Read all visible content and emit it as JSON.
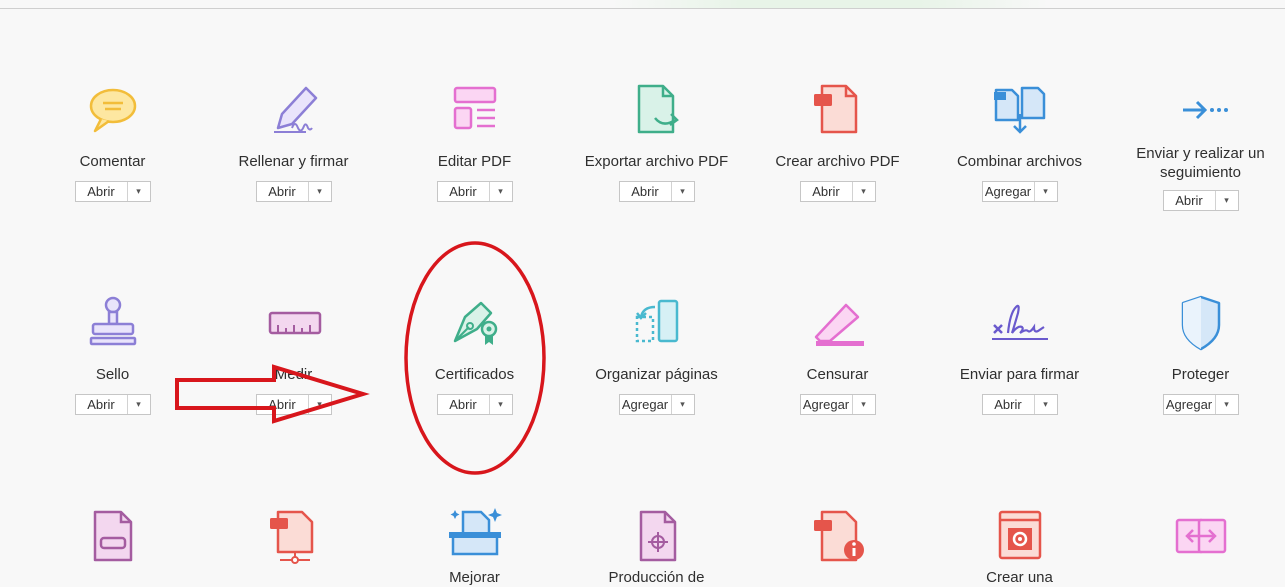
{
  "buttons": {
    "open": "Abrir",
    "add": "Agregar",
    "caret": "▾"
  },
  "row1": [
    {
      "name": "Comentar",
      "button": "Abrir",
      "icon": "comment-icon"
    },
    {
      "name": "Rellenar y firmar",
      "button": "Abrir",
      "icon": "fill-sign-icon"
    },
    {
      "name": "Editar PDF",
      "button": "Abrir",
      "icon": "edit-pdf-icon"
    },
    {
      "name": "Exportar archivo PDF",
      "button": "Abrir",
      "icon": "export-pdf-icon"
    },
    {
      "name": "Crear archivo PDF",
      "button": "Abrir",
      "icon": "create-pdf-icon"
    },
    {
      "name": "Combinar archivos",
      "button": "Agregar",
      "icon": "combine-files-icon"
    },
    {
      "name": "Enviar y realizar un seguimiento",
      "button": "Abrir",
      "icon": "send-track-icon"
    }
  ],
  "row2": [
    {
      "name": "Sello",
      "button": "Abrir",
      "icon": "stamp-icon"
    },
    {
      "name": "Medir",
      "button": "Abrir",
      "icon": "measure-icon"
    },
    {
      "name": "Certificados",
      "button": "Abrir",
      "icon": "certificates-icon"
    },
    {
      "name": "Organizar páginas",
      "button": "Agregar",
      "icon": "organize-pages-icon"
    },
    {
      "name": "Censurar",
      "button": "Agregar",
      "icon": "redact-icon"
    },
    {
      "name": "Enviar para firmar",
      "button": "Abrir",
      "icon": "send-for-signature-icon"
    },
    {
      "name": "Proteger",
      "button": "Agregar",
      "icon": "protect-icon"
    }
  ],
  "row3_partial": [
    {
      "name": "Mejorar",
      "icon": "enhance-scans-icon"
    },
    {
      "name": "Producción de",
      "icon": "print-production-icon"
    },
    {
      "name": "Crear una",
      "icon": "create-form-icon"
    }
  ],
  "row3_icons": [
    "rich-media-icon",
    "pdf-standards-icon",
    "enhance-scans-icon",
    "print-production-icon",
    "pdf-info-icon",
    "create-form-icon",
    "compare-files-icon"
  ],
  "colors": {
    "comment": "#f5c542",
    "fill_sign": "#8c7fd6",
    "edit_pdf": "#e46fd0",
    "export": "#3fae8a",
    "create": "#e5554b",
    "combine": "#3a8fd8",
    "annotation_red": "#d8161c"
  }
}
